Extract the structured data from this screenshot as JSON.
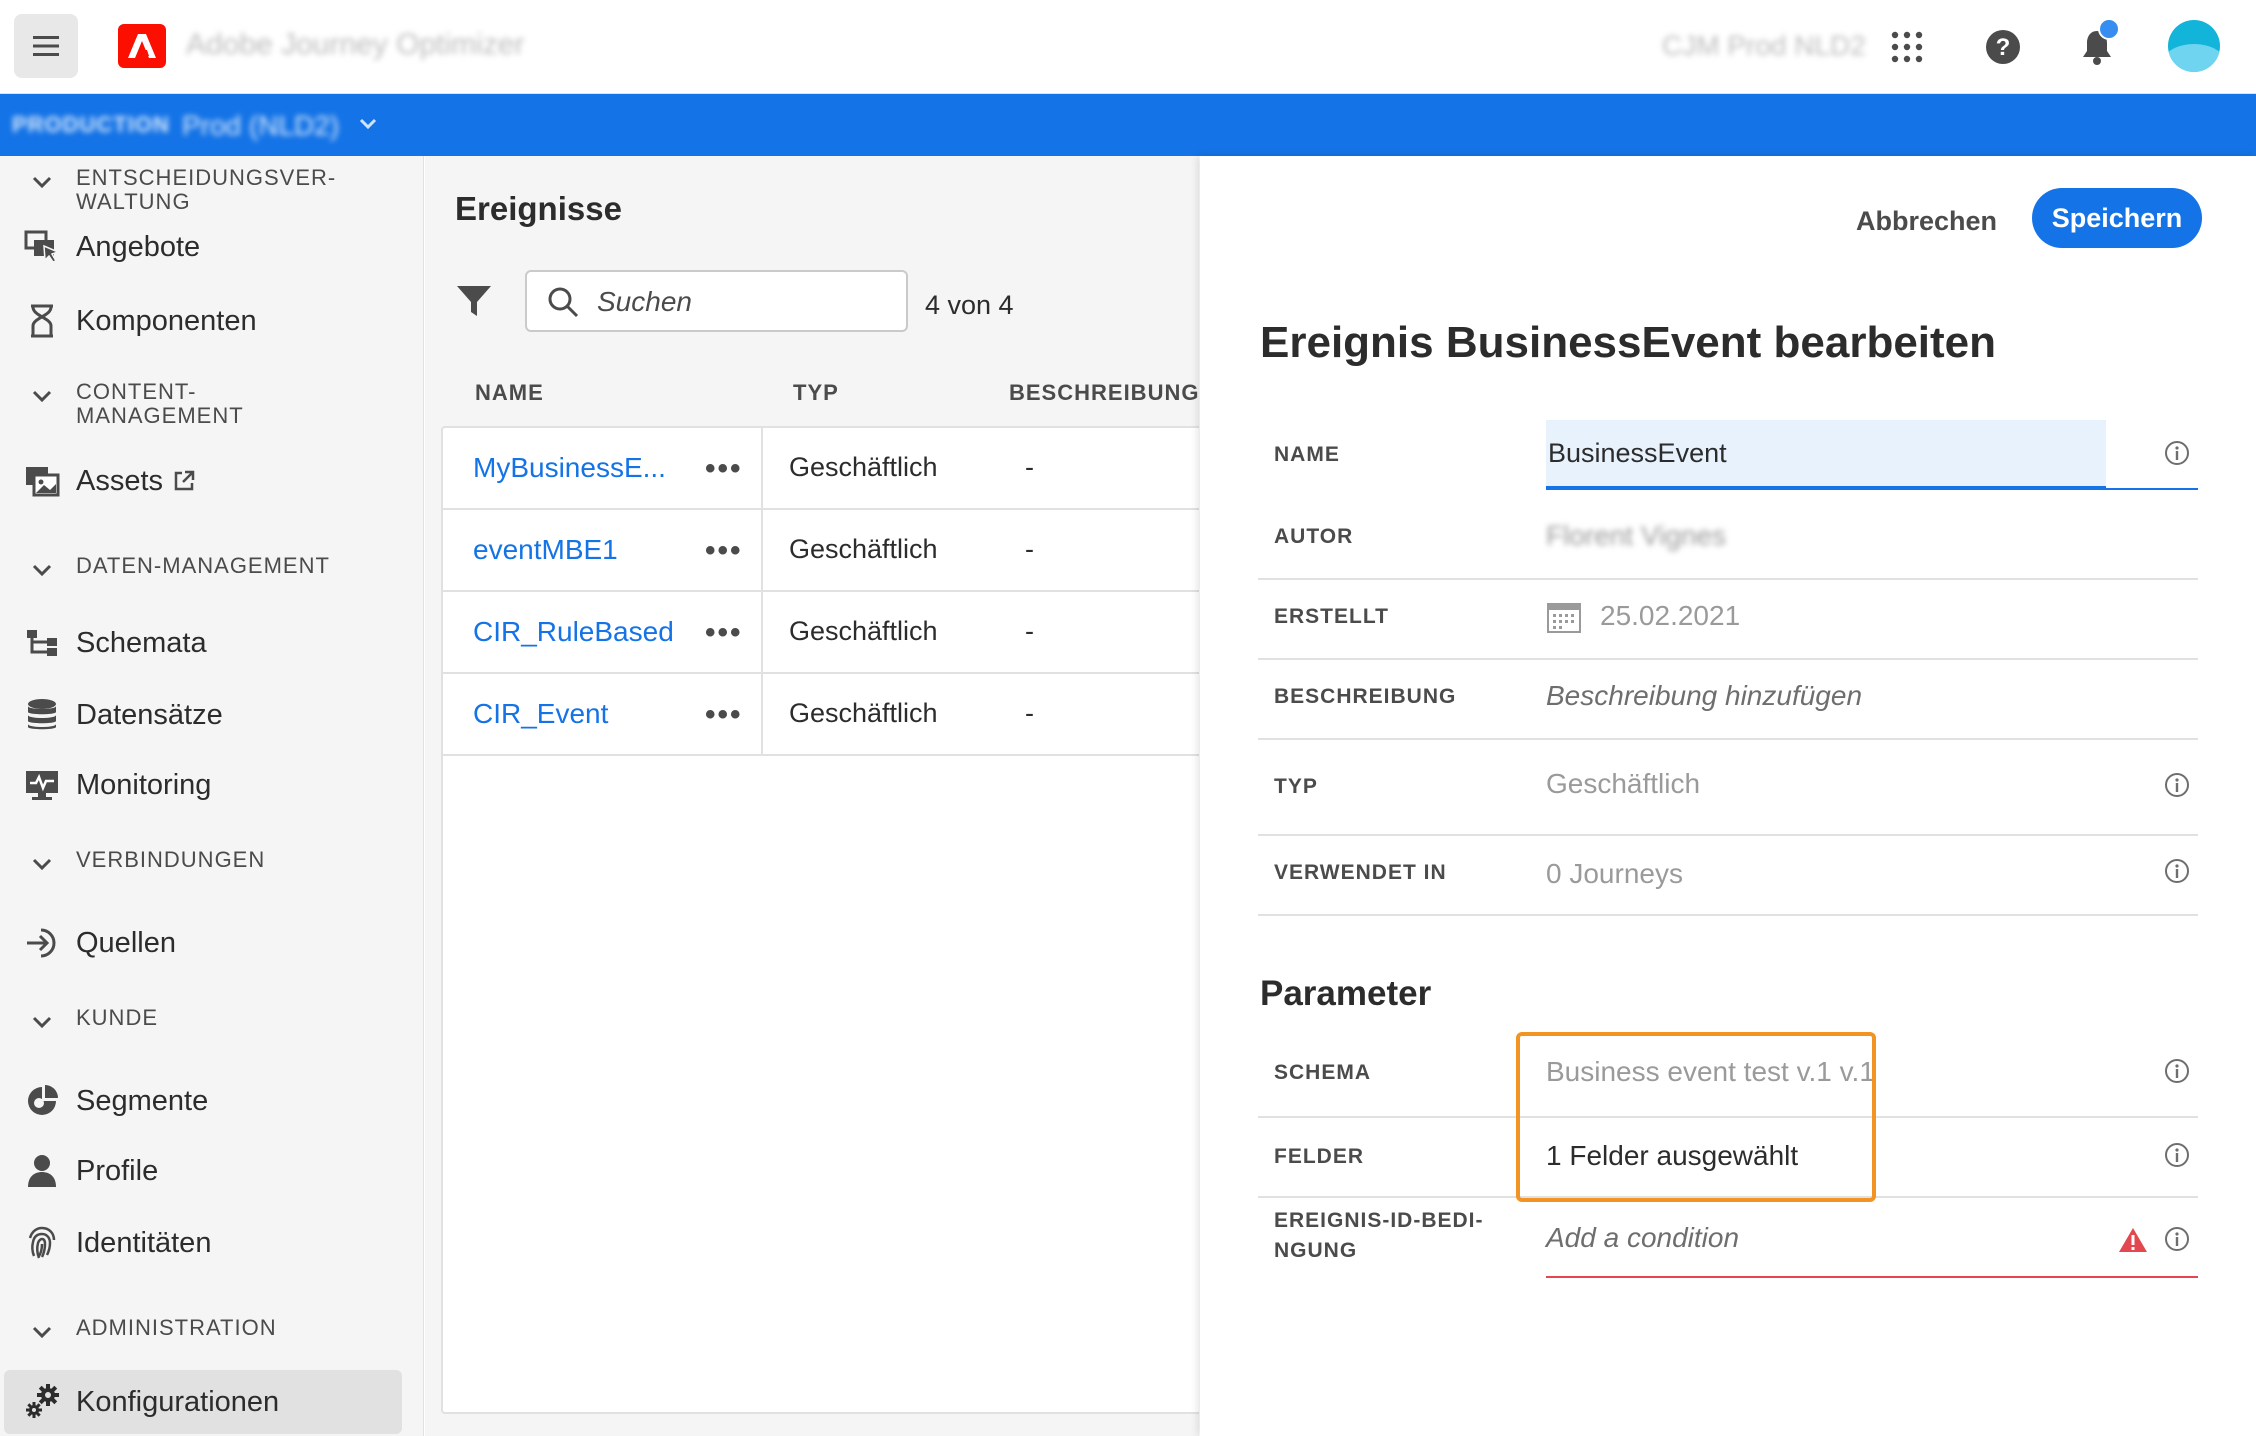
{
  "app": {
    "name": "Adobe Journey Optimizer",
    "org": "CJM Prod NLD2"
  },
  "sandbox": {
    "label": "PRODUCTION",
    "name": "Prod (NLD2)"
  },
  "sidebar": {
    "sections": [
      {
        "label": "ENTSCHEIDUNGSVER-\nWALTUNG"
      },
      {
        "label": "CONTENT-\nMANAGEMENT"
      },
      {
        "label": "DATEN-MANAGEMENT"
      },
      {
        "label": "VERBINDUNGEN"
      },
      {
        "label": "KUNDE"
      },
      {
        "label": "ADMINISTRATION"
      }
    ],
    "items": [
      {
        "label": "Angebote",
        "icon": "offers-icon"
      },
      {
        "label": "Komponenten",
        "icon": "components-icon"
      },
      {
        "label": "Assets",
        "icon": "assets-icon"
      },
      {
        "label": "Schemata",
        "icon": "schema-icon"
      },
      {
        "label": "Datensätze",
        "icon": "datasets-icon"
      },
      {
        "label": "Monitoring",
        "icon": "monitoring-icon"
      },
      {
        "label": "Quellen",
        "icon": "sources-icon"
      },
      {
        "label": "Segmente",
        "icon": "segments-icon"
      },
      {
        "label": "Profile",
        "icon": "profile-icon"
      },
      {
        "label": "Identitäten",
        "icon": "identities-icon"
      },
      {
        "label": "Konfigurationen",
        "icon": "gear-icon",
        "selected": true
      }
    ]
  },
  "events": {
    "title": "Ereignisse",
    "search_placeholder": "Suchen",
    "count": "4 von 4",
    "columns": [
      "NAME",
      "TYP",
      "BESCHREIBUNG"
    ],
    "rows": [
      {
        "name": "MyBusinessE...",
        "more": "•••",
        "type": "Geschäftlich",
        "desc": "-"
      },
      {
        "name": "eventMBE1",
        "more": "•••",
        "type": "Geschäftlich",
        "desc": "-"
      },
      {
        "name": "CIR_RuleBased",
        "more": "•••",
        "type": "Geschäftlich",
        "desc": "-"
      },
      {
        "name": "CIR_Event",
        "more": "•••",
        "type": "Geschäftlich",
        "desc": "-"
      }
    ]
  },
  "edit": {
    "cancel_label": "Abbrechen",
    "save_label": "Speichern",
    "title": "Ereignis BusinessEvent bearbeiten",
    "fields": {
      "name": {
        "label": "NAME",
        "value": "BusinessEvent"
      },
      "author": {
        "label": "AUTOR",
        "value": "Florent Vignes"
      },
      "created": {
        "label": "ERSTELLT",
        "value": "25.02.2021"
      },
      "description": {
        "label": "BESCHREIBUNG",
        "placeholder": "Beschreibung hinzufügen"
      },
      "type": {
        "label": "TYP",
        "value": "Geschäftlich"
      },
      "used_in": {
        "label": "VERWENDET IN",
        "value": "0 Journeys"
      }
    },
    "params_title": "Parameter",
    "params": {
      "schema": {
        "label": "SCHEMA",
        "value": "Business event test v.1 v.1"
      },
      "fields": {
        "label": "FELDER",
        "value": "1 Felder ausgewählt"
      },
      "id_condition": {
        "label": "EREIGNIS-ID-BEDI-\nNGUNG",
        "placeholder": "Add a condition"
      }
    },
    "colors": {
      "accent": "#1473e6",
      "highlight": "#f29423",
      "error": "#e34850"
    }
  }
}
